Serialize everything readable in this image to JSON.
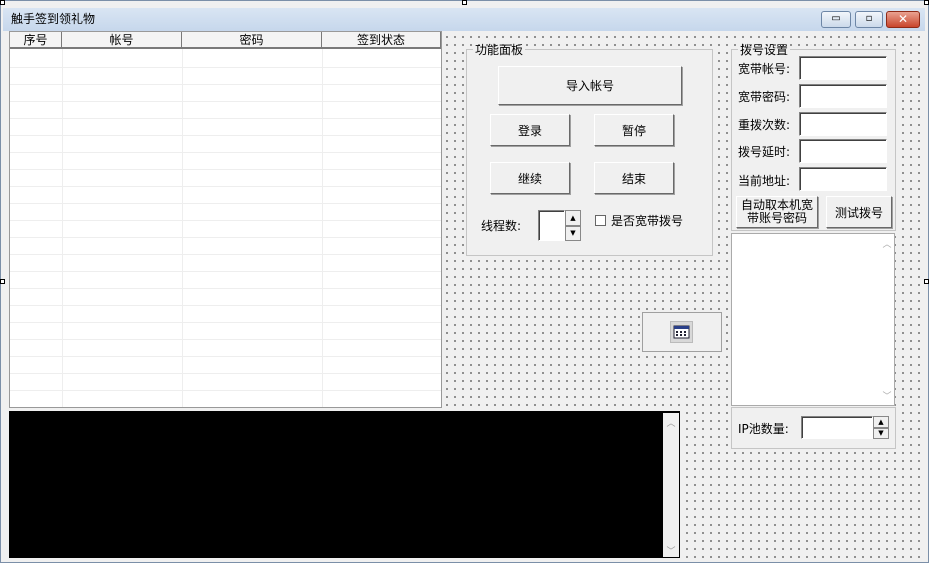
{
  "window": {
    "title": "触手签到领礼物",
    "buttons": {
      "minimize": "▭",
      "restore": "▫",
      "close": "✕"
    }
  },
  "grid": {
    "columns": [
      "序号",
      "帐号",
      "密码",
      "签到状态"
    ],
    "row_count": 21
  },
  "function_panel": {
    "legend": "功能面板",
    "import_button": "导入帐号",
    "login_button": "登录",
    "pause_button": "暂停",
    "continue_button": "继续",
    "end_button": "结束",
    "threads_label": "线程数:",
    "threads_value": "",
    "broadband_checkbox_label": "是否宽带拨号",
    "broadband_checked": false
  },
  "dial_settings": {
    "legend": "拨号设置",
    "account_label": "宽带帐号:",
    "account_value": "",
    "password_label": "宽带密码:",
    "password_value": "",
    "redial_label": "重拨次数:",
    "redial_value": "",
    "delay_label": "拨号延时:",
    "delay_value": "",
    "address_label": "当前地址:",
    "address_value": "",
    "auto_fetch_button": "自动取本机宽带账号密码",
    "test_dial_button": "测试拨号"
  },
  "ip_pool": {
    "label": "IP池数量:",
    "value": ""
  },
  "icons": {
    "timer_control": "calendar-icon",
    "spin_up": "▲",
    "spin_down": "▼",
    "scroll_up": "︿",
    "scroll_down": "﹀"
  }
}
